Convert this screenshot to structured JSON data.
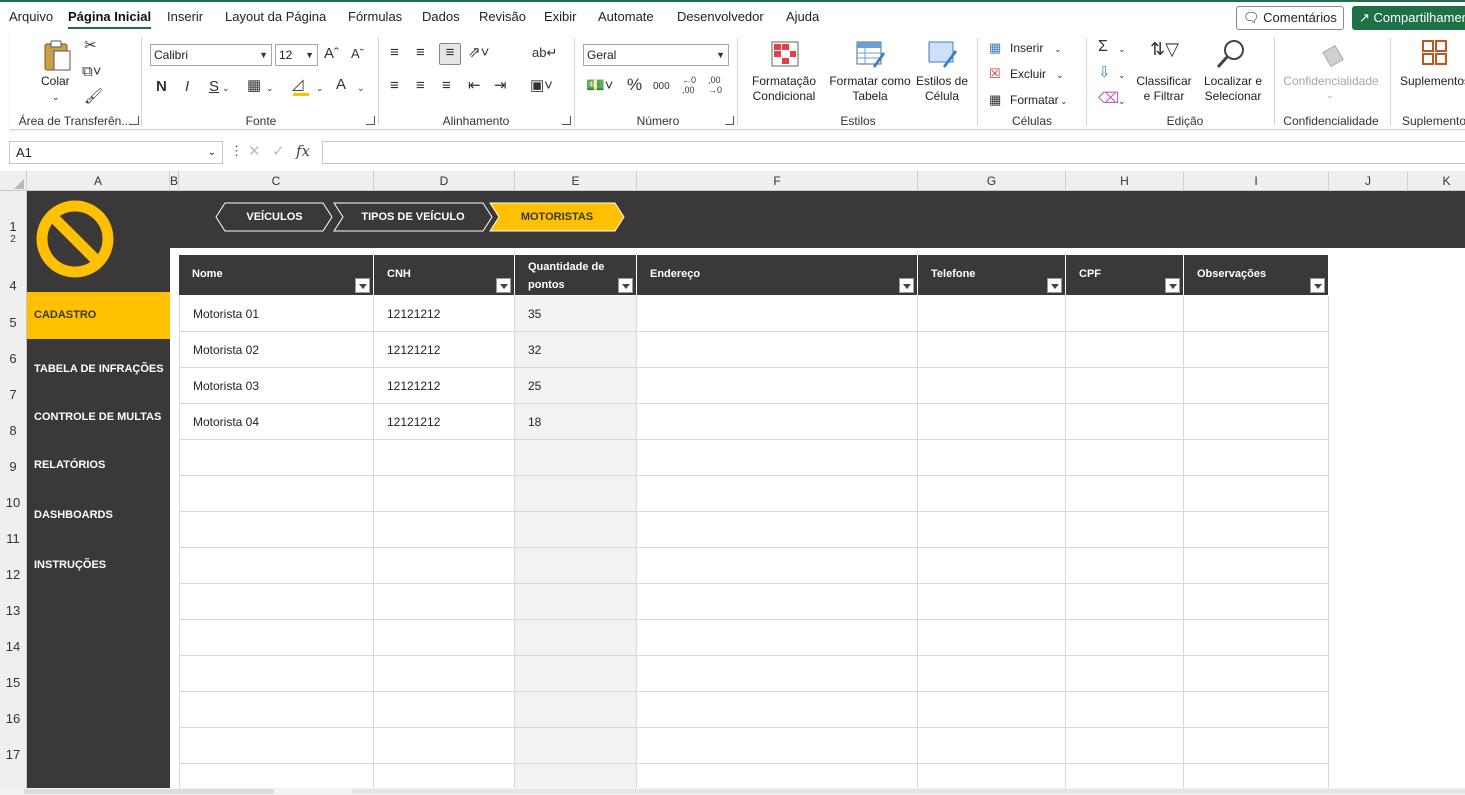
{
  "menu": {
    "items": [
      "Arquivo",
      "Página Inicial",
      "Inserir",
      "Layout da Página",
      "Fórmulas",
      "Dados",
      "Revisão",
      "Exibir",
      "Automate",
      "Desenvolvedor",
      "Ajuda"
    ],
    "active": "Página Inicial",
    "comments_label": "Comentários",
    "share_label": "Compartilhamento"
  },
  "ribbon": {
    "clipboard": {
      "paste_label": "Colar",
      "group": "Área de Transferên..."
    },
    "font": {
      "name": "Calibri",
      "size": "12",
      "bold": "N",
      "italic": "I",
      "underline": "S",
      "group": "Fonte"
    },
    "alignment": {
      "group": "Alinhamento"
    },
    "number": {
      "format": "Geral",
      "group": "Número"
    },
    "styles": {
      "conditional": [
        "Formatação",
        "Condicional"
      ],
      "format_table": [
        "Formatar como",
        "Tabela"
      ],
      "cell_styles": [
        "Estilos de",
        "Célula"
      ],
      "group": "Estilos"
    },
    "cells": {
      "insert": "Inserir",
      "delete": "Excluir",
      "format": "Formatar",
      "group": "Células"
    },
    "editing": {
      "sort": [
        "Classificar",
        "e Filtrar"
      ],
      "find": [
        "Localizar e",
        "Selecionar"
      ],
      "group": "Edição"
    },
    "sensitivity": {
      "label": "Confidencialidade",
      "group": "Confidencialidade"
    },
    "addins": {
      "label": "Suplementos",
      "group": "Suplementos"
    }
  },
  "formula_bar": {
    "name_box": "A1",
    "fx": "fx",
    "value": ""
  },
  "columns": [
    "A",
    "B",
    "C",
    "D",
    "E",
    "F",
    "G",
    "H",
    "I",
    "J",
    "K"
  ],
  "rows": [
    "1",
    "2",
    "4",
    "5",
    "6",
    "7",
    "8",
    "9",
    "10",
    "11",
    "12",
    "13",
    "14",
    "15",
    "16",
    "17"
  ],
  "sidebar": {
    "items": [
      "CADASTRO",
      "TABELA DE INFRAÇÕES",
      "CONTROLE DE MULTAS",
      "RELATÓRIOS",
      "DASHBOARDS",
      "INSTRUÇÕES"
    ],
    "active": "CADASTRO"
  },
  "tabs": {
    "items": [
      "VEÍCULOS",
      "TIPOS DE VEÍCULO",
      "MOTORISTAS"
    ],
    "active": "MOTORISTAS"
  },
  "table": {
    "headers": [
      "Nome",
      "CNH",
      "Quantidade de pontos",
      "Endereço",
      "Telefone",
      "CPF",
      "Observações"
    ],
    "rows": [
      [
        "Motorista 01",
        "12121212",
        "35",
        "",
        "",
        "",
        ""
      ],
      [
        "Motorista 02",
        "12121212",
        "32",
        "",
        "",
        "",
        ""
      ],
      [
        "Motorista 03",
        "12121212",
        "25",
        "",
        "",
        "",
        ""
      ],
      [
        "Motorista 04",
        "12121212",
        "18",
        "",
        "",
        "",
        ""
      ]
    ],
    "empty_rows": 10
  },
  "colors": {
    "accent": "#ffc000",
    "dark": "#3a3838",
    "excel_green": "#1e7145"
  }
}
